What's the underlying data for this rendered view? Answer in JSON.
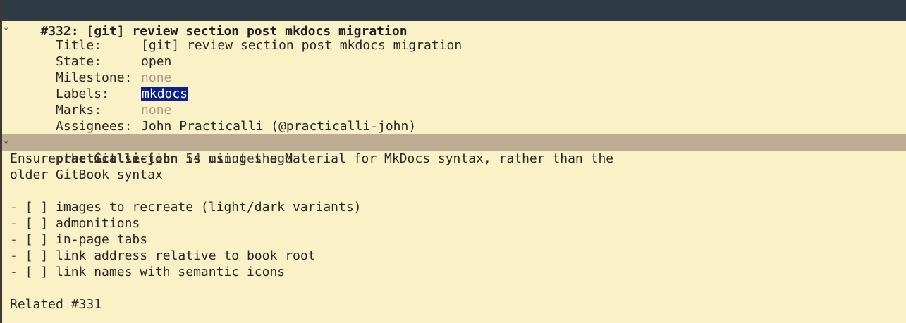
{
  "issue": {
    "header": "#332: [git] review section post mkdocs migration",
    "fields": [
      {
        "key": "Title:",
        "value": "[git] review section post mkdocs migration",
        "style": "normal"
      },
      {
        "key": "State:",
        "value": "open",
        "style": "normal"
      },
      {
        "key": "Milestone:",
        "value": "none",
        "style": "dim"
      },
      {
        "key": "Labels:",
        "value": "mkdocs",
        "style": "tag"
      },
      {
        "key": "Marks:",
        "value": "none",
        "style": "dim"
      },
      {
        "key": "Assignees:",
        "value": "John Practicalli (@practicalli-john)",
        "style": "normal"
      }
    ]
  },
  "comment": {
    "author": "practicalli-john",
    "time": "54 minutes ago",
    "body_lines": [
      "Ensure the Git section is using the Material for MkDocs syntax, rather than the",
      "older GitBook syntax"
    ],
    "checklist": [
      "[ ] images to recreate (light/dark variants)",
      "[ ] admonitions",
      "[ ] in-page tabs",
      "[ ] link address relative to book root",
      "[ ] link names with semantic icons"
    ],
    "bullet": "-",
    "related": "Related #331"
  },
  "icons": {
    "fold": "⌄"
  },
  "colors": {
    "background": "#fbf1c7",
    "header_bar": "#2f3b45",
    "comment_header": "#bdae93",
    "label_tag": "#0c1f8c",
    "bullet": "#cc241d",
    "dim_text": "#a89984"
  }
}
